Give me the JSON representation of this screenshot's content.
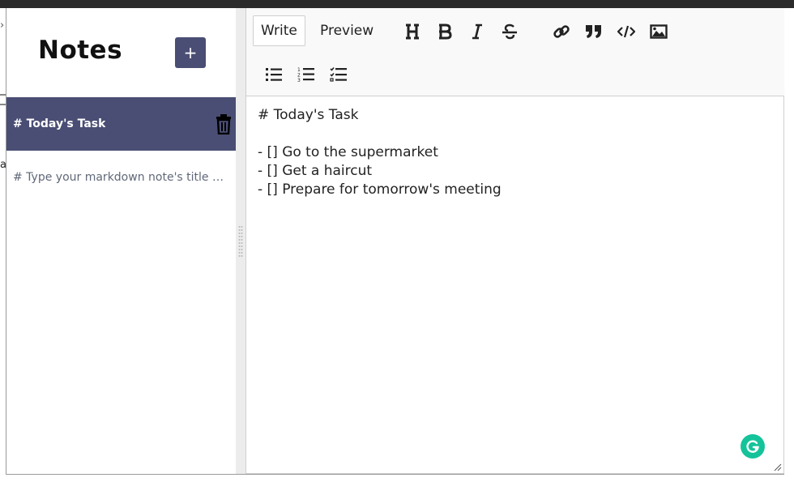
{
  "sidebar": {
    "title": "Notes",
    "new_note_label": "+",
    "notes": [
      {
        "title": "# Today's Task",
        "active": true
      },
      {
        "title": "# Type your markdown note's title here",
        "active": false
      }
    ]
  },
  "editor": {
    "tabs": [
      {
        "label": "Write",
        "active": true
      },
      {
        "label": "Preview",
        "active": false
      }
    ],
    "toolbar_icons": [
      "heading-icon",
      "bold-icon",
      "italic-icon",
      "strikethrough-icon",
      "link-icon",
      "quote-icon",
      "code-icon",
      "image-icon",
      "unordered-list-icon",
      "ordered-list-icon",
      "checklist-icon"
    ],
    "content": "# Today's Task\n\n- [] Go to the supermarket\n- [] Get a haircut\n- [] Prepare for tomorrow's meeting"
  },
  "background": {
    "chevron": "›",
    "letter": "a"
  },
  "colors": {
    "accent": "#4a4e74",
    "top_bar": "#2b2b2b",
    "grammarly": "#15c39a"
  }
}
